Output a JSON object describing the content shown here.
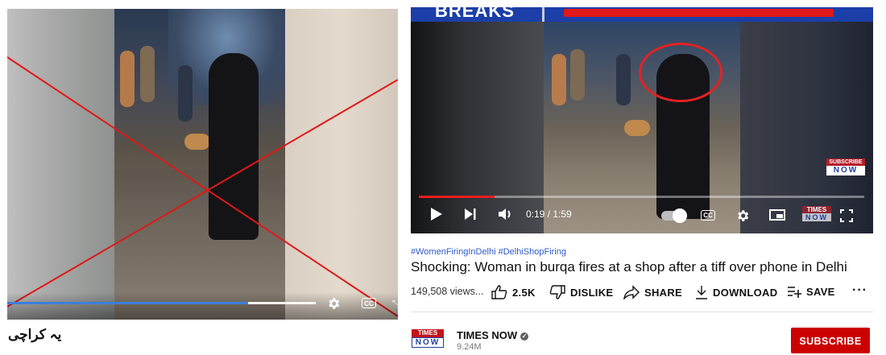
{
  "left_post": {
    "caption": "یہ کراچی",
    "player": {
      "progress_fraction": 0.78,
      "cc_label": "CC"
    }
  },
  "right_post": {
    "banner_text": "BREAKS",
    "player": {
      "time_display": "0:19 / 1:59",
      "progress_fraction": 0.17,
      "cc_label": "CC",
      "subscribe_badge": {
        "top": "SUBSCRIBE",
        "bottom": "NOW"
      },
      "watermark": {
        "top": "TIMES",
        "bottom": "NOW"
      }
    },
    "hashtags": "#WomenFiringInDelhi #DelhiShopFiring",
    "title": "Shocking: Woman in burqa fires at a shop after a tiff over phone in Delhi",
    "views": "149,508 views...",
    "actions": {
      "like_count": "2.5K",
      "dislike_label": "DISLIKE",
      "share_label": "SHARE",
      "download_label": "DOWNLOAD",
      "save_label": "SAVE",
      "more_label": "···"
    },
    "channel": {
      "logo_top": "TIMES",
      "logo_bottom": "NOW",
      "name": "TIMES NOW",
      "subscribers": "9.24M subscribers",
      "subscribe_label": "SUBSCRIBE"
    }
  },
  "colors": {
    "cross_red": "#e01818",
    "yt_red": "#cc0000",
    "left_progress": "#3d7fd8",
    "hashtag_blue": "#2d59c9"
  }
}
